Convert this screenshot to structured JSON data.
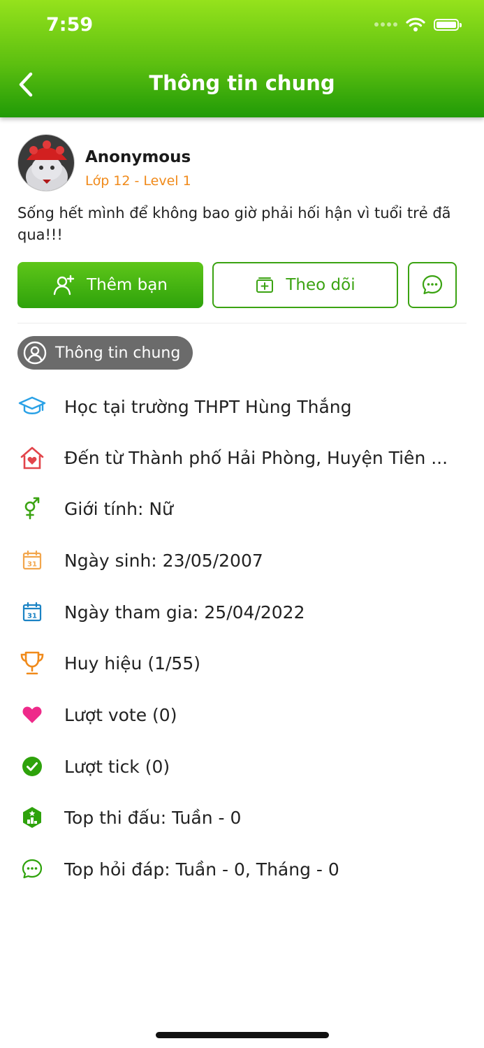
{
  "status_bar": {
    "time": "7:59"
  },
  "header": {
    "title": "Thông tin chung"
  },
  "profile": {
    "name": "Anonymous",
    "level": "Lớp 12 - Level 1",
    "bio": "Sống hết mình để không bao giờ phải hối hận vì tuổi trẻ đã qua!!!"
  },
  "actions": {
    "add_friend": "Thêm bạn",
    "follow": "Theo dõi"
  },
  "section": {
    "label": "Thông tin chung"
  },
  "info": [
    {
      "icon": "graduation-cap-icon",
      "text": "Học tại trường THPT Hùng Thắng"
    },
    {
      "icon": "home-heart-icon",
      "text": "Đến từ Thành phố Hải Phòng, Huyện Tiên ..."
    },
    {
      "icon": "gender-icon",
      "text": "Giới tính: Nữ"
    },
    {
      "icon": "calendar-birthday-icon",
      "text": "Ngày sinh: 23/05/2007"
    },
    {
      "icon": "calendar-join-icon",
      "text": "Ngày tham gia: 25/04/2022"
    },
    {
      "icon": "trophy-icon",
      "text": "Huy hiệu (1/55)"
    },
    {
      "icon": "heart-icon",
      "text": "Lượt vote (0)"
    },
    {
      "icon": "check-circle-icon",
      "text": "Lượt tick (0)"
    },
    {
      "icon": "ranking-icon",
      "text": "Top thi đấu: Tuần - 0"
    },
    {
      "icon": "chat-bubble-icon",
      "text": "Top hỏi đáp: Tuần - 0, Tháng - 0"
    }
  ],
  "colors": {
    "brand_green": "#3ba312",
    "level_orange": "#f08a1a",
    "chip_gray": "#6b6b6b"
  }
}
